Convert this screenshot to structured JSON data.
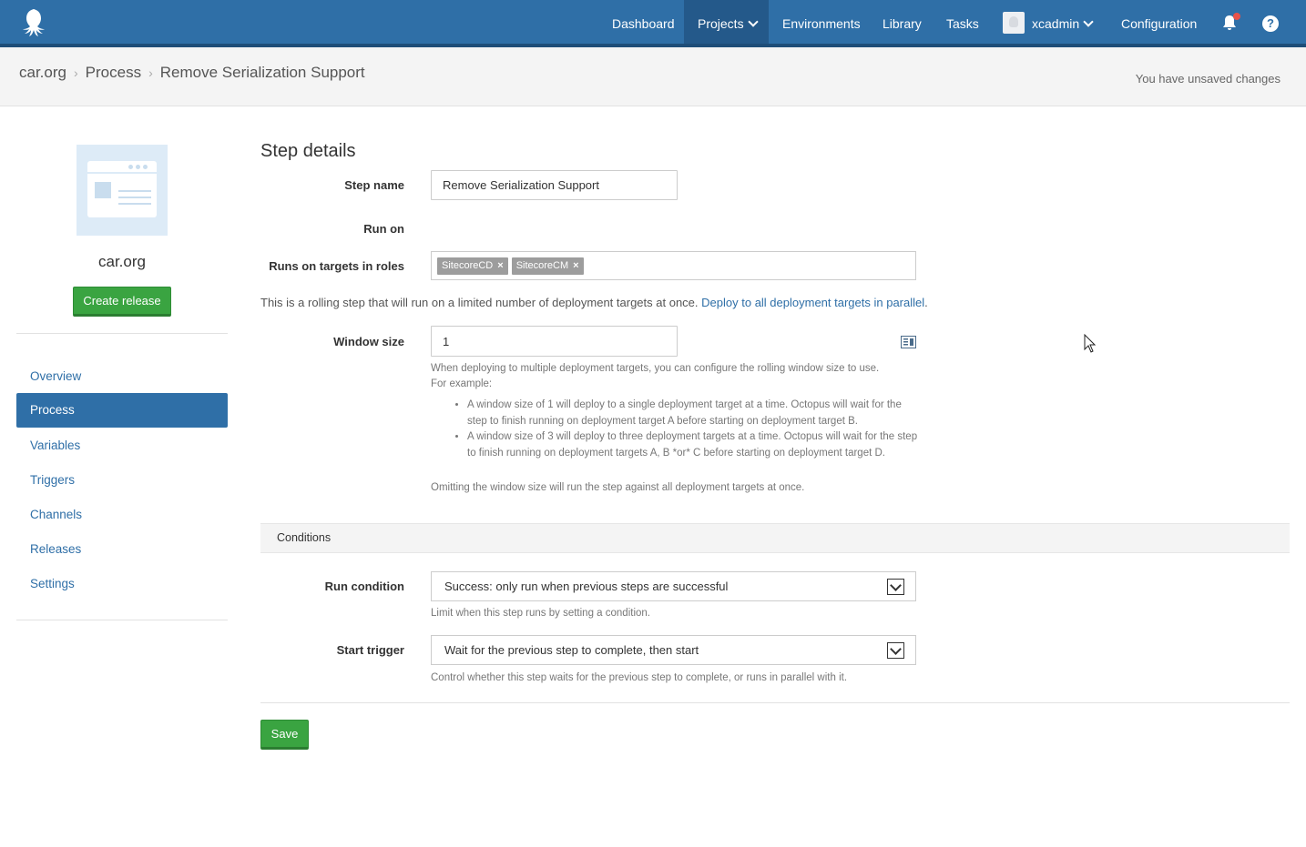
{
  "nav": {
    "items": [
      "Dashboard",
      "Projects",
      "Environments",
      "Library",
      "Tasks"
    ],
    "user": "xcadmin",
    "configuration": "Configuration",
    "help": "?"
  },
  "breadcrumb": {
    "project": "car.org",
    "section": "Process",
    "current": "Remove Serialization Support"
  },
  "unsaved": "You have unsaved changes",
  "sidebar": {
    "project_name": "car.org",
    "create_release": "Create release",
    "items": [
      "Overview",
      "Process",
      "Variables",
      "Triggers",
      "Channels",
      "Releases",
      "Settings"
    ],
    "active": "Process"
  },
  "step": {
    "heading": "Step details",
    "name_label": "Step name",
    "name_value": "Remove Serialization Support",
    "run_on_label": "Run on",
    "roles_label": "Runs on targets in roles",
    "roles": [
      "SitecoreCD",
      "SitecoreCM"
    ],
    "rolling_text": "This is a rolling step that will run on a limited number of deployment targets at once.",
    "rolling_link": "Deploy to all deployment targets in parallel",
    "rolling_period": ".",
    "window_label": "Window size",
    "window_value": "1",
    "window_help_1": "When deploying to multiple deployment targets, you can configure the rolling window size to use.",
    "window_help_2": "For example:",
    "window_examples": [
      "A window size of 1 will deploy to a single deployment target at a time. Octopus will wait for the step to finish running on deployment target A before starting on deployment target B.",
      "A window size of 3 will deploy to three deployment targets at a time. Octopus will wait for the step to finish running on deployment targets A, B *or* C before starting on deployment target D."
    ],
    "window_help_3": "Omitting the window size will run the step against all deployment targets at once."
  },
  "conditions": {
    "title": "Conditions",
    "run_condition_label": "Run condition",
    "run_condition_value": "Success: only run when previous steps are successful",
    "run_condition_help": "Limit when this step runs by setting a condition.",
    "start_trigger_label": "Start trigger",
    "start_trigger_value": "Wait for the previous step to complete, then start",
    "start_trigger_help": "Control whether this step waits for the previous step to complete, or runs in parallel with it."
  },
  "save_label": "Save",
  "colors": {
    "nav": "#2f6fa7",
    "accent": "#2f6fa7",
    "green": "#3aa441",
    "badge": "#e8524a"
  }
}
